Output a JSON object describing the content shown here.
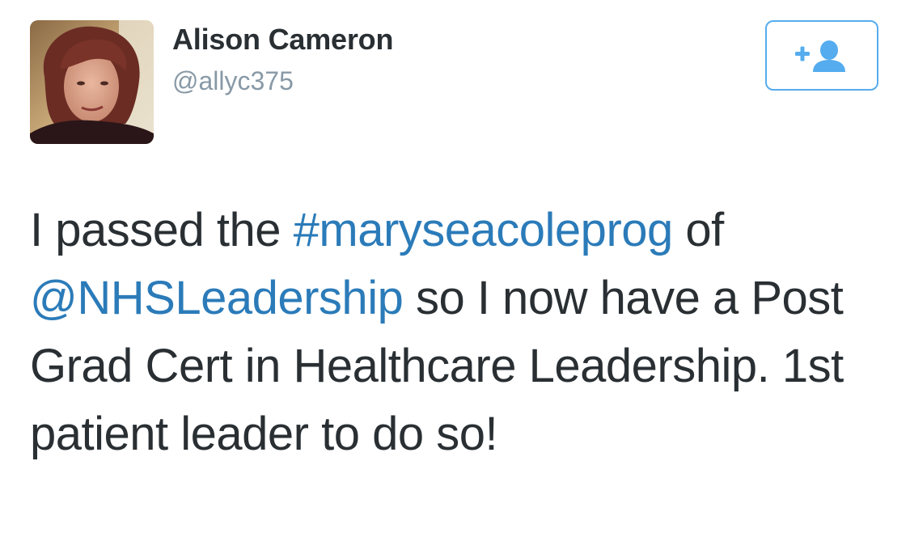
{
  "user": {
    "display_name": "Alison Cameron",
    "handle": "@allyc375",
    "avatar_icon": "profile-photo"
  },
  "follow_button": {
    "icon": "follow-person-plus-icon",
    "accent_color": "#55acee"
  },
  "tweet": {
    "segments": [
      {
        "type": "text",
        "text": "I passed the "
      },
      {
        "type": "hashtag",
        "text": "#maryseacoleprog"
      },
      {
        "type": "text",
        "text": " of "
      },
      {
        "type": "mention",
        "text": "@NHSLeadership"
      },
      {
        "type": "text",
        "text": " so I now have a Post Grad Cert in Healthcare Leadership. 1st patient leader to do so!"
      }
    ]
  },
  "colors": {
    "text": "#292f33",
    "secondary_text": "#8899a6",
    "link": "#2b7bb9",
    "accent": "#55acee"
  }
}
